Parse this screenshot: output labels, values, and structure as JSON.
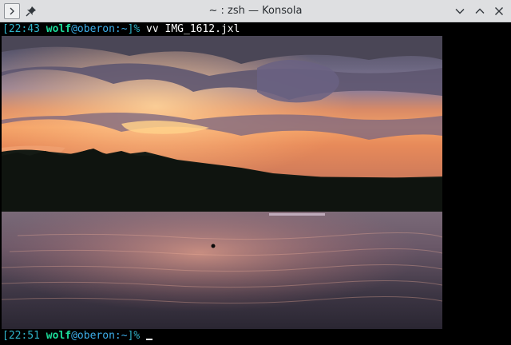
{
  "window": {
    "title": "~ : zsh — Konsola"
  },
  "prompt1": {
    "time": "[22:43",
    "user": "wolf",
    "at": "@oberon",
    "path": ":~",
    "bracket": "]%",
    "command": " vv IMG_1612.jxl"
  },
  "prompt2": {
    "time": "[22:51",
    "user": "wolf",
    "at": "@oberon",
    "path": ":~",
    "bracket": "]%",
    "command": " "
  },
  "icons": {
    "menu": "chevron-right-icon",
    "pin": "pin-icon",
    "minimize": "chevron-down-icon",
    "maximize": "chevron-up-icon",
    "close": "close-icon"
  },
  "colors": {
    "timestamp": "#2fb4c9",
    "user": "#1cdc9a",
    "host": "#3daee9",
    "titlebar": "#dedfe1"
  }
}
